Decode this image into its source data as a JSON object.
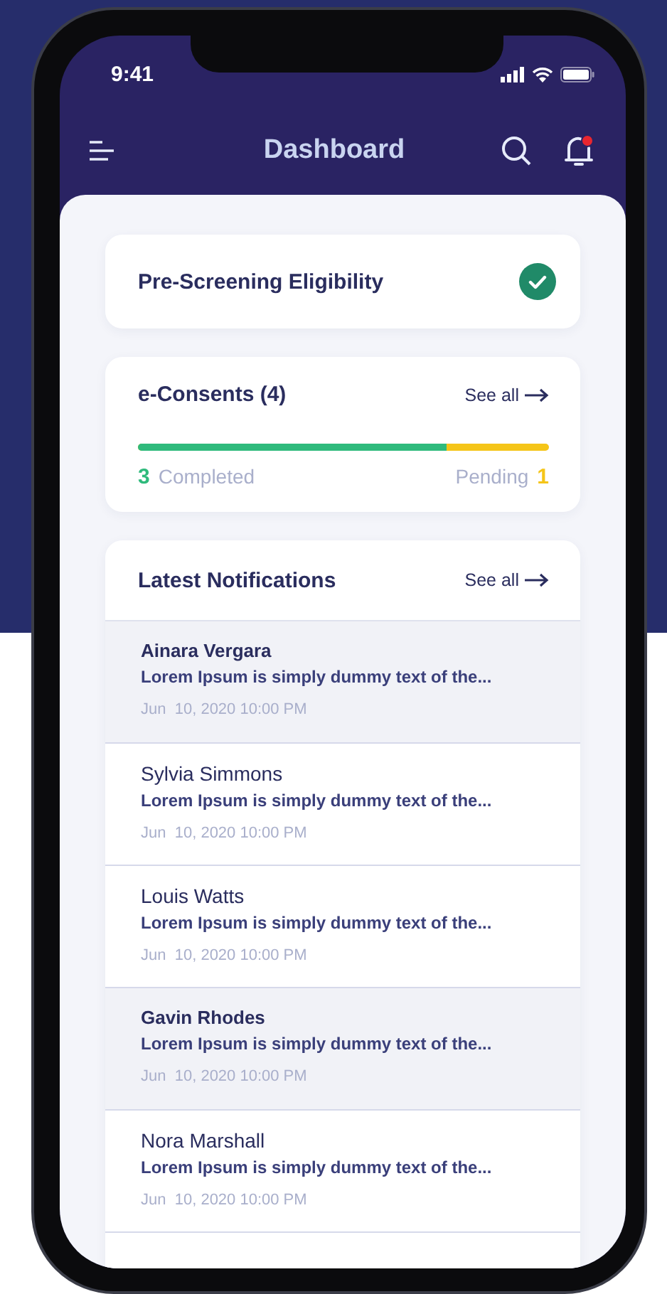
{
  "status_bar": {
    "time": "9:41"
  },
  "header": {
    "title": "Dashboard",
    "has_unread_alert": true
  },
  "eligibility": {
    "title": "Pre-Screening Eligibility",
    "eligible": true
  },
  "consents": {
    "title": "e-Consents (4)",
    "see_all": "See all",
    "level": 0.75,
    "completed_count": "3",
    "completed_label": "Completed",
    "pending_label": "Pending",
    "pending_count": "1"
  },
  "notifications": {
    "title": "Latest Notifications",
    "see_all": "See all",
    "items": [
      {
        "name": "Ainara Vergara",
        "message": "Lorem Ipsum is simply dummy text of the...",
        "time": "Jun  10, 2020 10:00 PM",
        "unread": true
      },
      {
        "name": "Sylvia Simmons",
        "message": "Lorem Ipsum is simply dummy text of the...",
        "time": "Jun  10, 2020 10:00 PM",
        "unread": false
      },
      {
        "name": "Louis Watts",
        "message": "Lorem Ipsum is simply dummy text of the...",
        "time": "Jun  10, 2020 10:00 PM",
        "unread": false
      },
      {
        "name": "Gavin Rhodes",
        "message": "Lorem Ipsum is simply dummy text of the...",
        "time": "Jun  10, 2020 10:00 PM",
        "unread": true
      },
      {
        "name": "Nora Marshall",
        "message": "Lorem Ipsum is simply dummy text of the...",
        "time": "Jun  10, 2020 10:00 PM",
        "unread": false
      }
    ]
  }
}
